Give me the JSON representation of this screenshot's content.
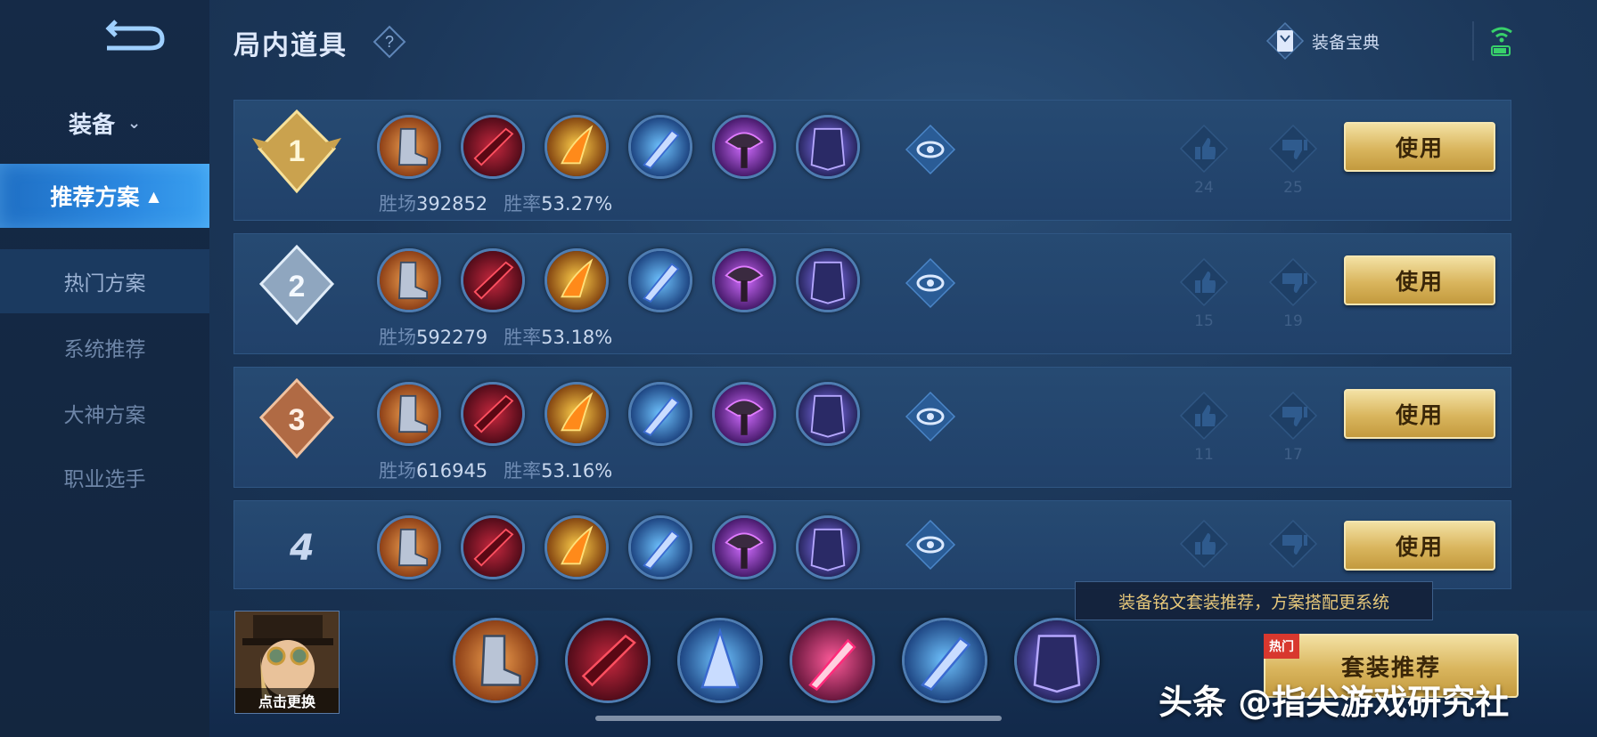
{
  "header": {
    "title": "局内道具",
    "codex_label": "装备宝典"
  },
  "sidebar": {
    "group_label": "装备",
    "items": [
      {
        "label": "推荐方案"
      },
      {
        "label": "热门方案"
      },
      {
        "label": "系统推荐"
      },
      {
        "label": "大神方案"
      },
      {
        "label": "职业选手"
      }
    ]
  },
  "plans": [
    {
      "rank": "1",
      "wins_label": "胜场",
      "wins": "392852",
      "rate_label": "胜率",
      "rate": "53.27%",
      "likes": "24",
      "dislikes": "25",
      "use_label": "使用"
    },
    {
      "rank": "2",
      "wins_label": "胜场",
      "wins": "592279",
      "rate_label": "胜率",
      "rate": "53.18%",
      "likes": "15",
      "dislikes": "19",
      "use_label": "使用"
    },
    {
      "rank": "3",
      "wins_label": "胜场",
      "wins": "616945",
      "rate_label": "胜率",
      "rate": "53.16%",
      "likes": "11",
      "dislikes": "17",
      "use_label": "使用"
    },
    {
      "rank": "4",
      "use_label": "使用"
    }
  ],
  "item_icons": [
    "boots-icon",
    "red-blade-icon",
    "fire-wing-icon",
    "blue-spear-icon",
    "purple-axe-icon",
    "purple-armor-icon"
  ],
  "bottom": {
    "hero_caption": "点击更换",
    "tooltip": "装备铭文套装推荐，方案搭配更系统",
    "suit_button": "套装推荐",
    "hot_tag": "热门",
    "big_item_icons": [
      "boots-icon",
      "red-blade-icon",
      "blue-spear-icon",
      "pink-staff-icon",
      "blue-spear-icon",
      "purple-armor-icon"
    ]
  },
  "watermark": "头条 @指尖游戏研究社",
  "colors": {
    "gold_button": "#d9b55d",
    "active_nav": "#2b88e0",
    "stat_value": "#c9d8ee"
  }
}
